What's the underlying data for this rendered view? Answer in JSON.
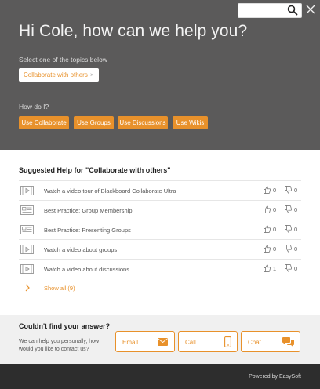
{
  "search": {
    "placeholder": "",
    "icon": "search-icon"
  },
  "header": {
    "greeting": "Hi Cole, how can we help you?",
    "select_label": "Select one of the topics below",
    "selected_topic": "Collaborate with others",
    "remove_symbol": "×",
    "how_do_i_label": "How do I?",
    "how_do_i_buttons": [
      "Use Collaborate",
      "Use Groups",
      "Use Discussions",
      "Use Wikis"
    ]
  },
  "suggested": {
    "title": "Suggested Help for \"Collaborate with others\"",
    "items": [
      {
        "icon": "video-icon",
        "text": "Watch a video tour of Blackboard Collaborate Ultra",
        "likes": "0",
        "dislikes": "0"
      },
      {
        "icon": "document-icon",
        "text": "Best Practice: Group Membership",
        "likes": "0",
        "dislikes": "0"
      },
      {
        "icon": "document-icon",
        "text": "Best Practice: Presenting Groups",
        "likes": "0",
        "dislikes": "0"
      },
      {
        "icon": "video-icon",
        "text": "Watch a video about groups",
        "likes": "0",
        "dislikes": "0"
      },
      {
        "icon": "video-icon",
        "text": "Watch a video about discussions",
        "likes": "1",
        "dislikes": "0"
      }
    ],
    "show_all": "Show all (9)"
  },
  "contact": {
    "title": "Couldn't find your answer?",
    "description": "We can help you personally, how would you like to contact us?",
    "options": [
      {
        "label": "Email",
        "icon": "envelope-icon"
      },
      {
        "label": "Call",
        "icon": "phone-icon"
      },
      {
        "label": "Chat",
        "icon": "chat-bubbles-icon"
      }
    ]
  },
  "footer": {
    "powered_by": "Powered by EasySoft"
  },
  "colors": {
    "accent": "#e8912b",
    "header_bg": "#5b5a5a",
    "footer_bg": "#2d2d2d"
  }
}
